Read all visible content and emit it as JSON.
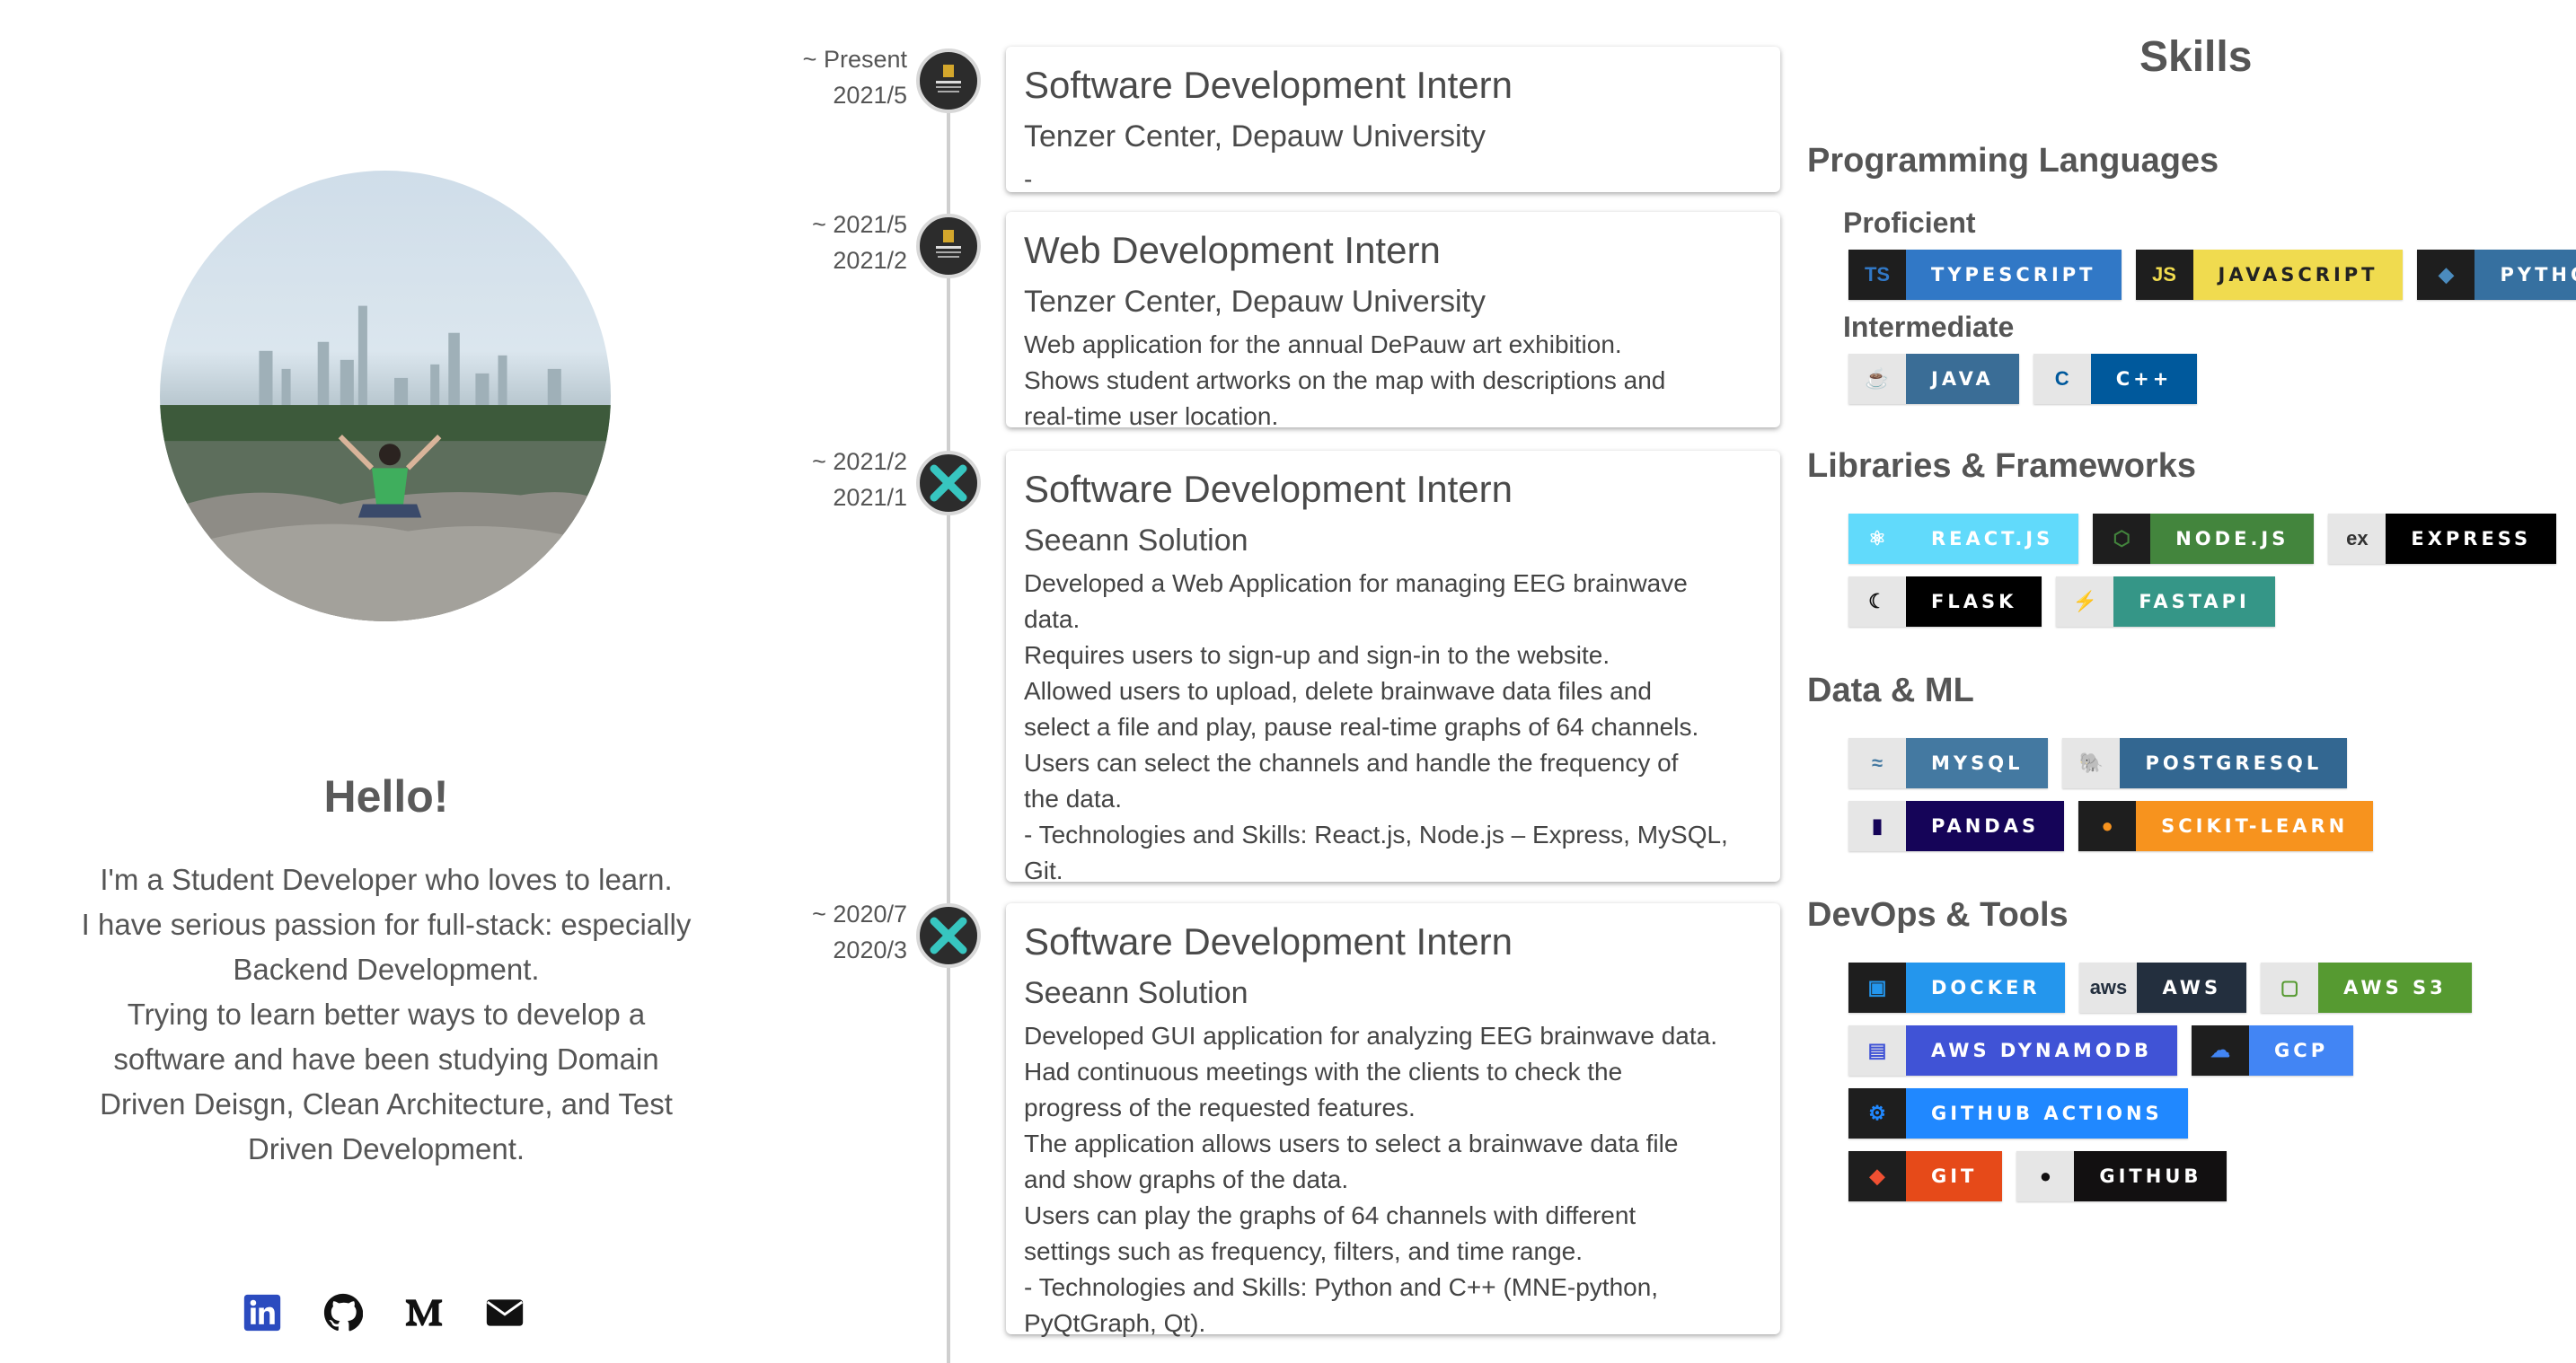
{
  "profile": {
    "greeting": "Hello!",
    "bio_lines": [
      "I'm a Student Developer who loves to learn.",
      "I have serious passion for full-stack: especially",
      "Backend Development.",
      "Trying to learn better ways to develop a",
      "software and have been studying Domain",
      "Driven Deisgn, Clean Architecture, and Test",
      "Driven Development."
    ],
    "socials": [
      "linkedin-icon",
      "github-icon",
      "medium-icon",
      "email-icon"
    ]
  },
  "timeline": [
    {
      "date_end": "~ Present",
      "date_start": "2021/5",
      "logo": "depauw-logo",
      "title": "Software Development Intern",
      "org": "Tenzer Center, Depauw University",
      "desc": [
        "-"
      ]
    },
    {
      "date_end": "~ 2021/5",
      "date_start": "2021/2",
      "logo": "depauw-logo",
      "title": "Web Development Intern",
      "org": "Tenzer Center, Depauw University",
      "desc": [
        "Web application for the annual DePauw art exhibition.",
        "Shows student artworks on the map with descriptions and",
        "real-time user location."
      ]
    },
    {
      "date_end": "~ 2021/2",
      "date_start": "2021/1",
      "logo": "seeann-logo",
      "title": "Software Development Intern",
      "org": "Seeann Solution",
      "desc": [
        "Developed a Web Application for managing EEG brainwave",
        "data.",
        "Requires users to sign-up and sign-in to the website.",
        "Allowed users to upload, delete brainwave data files and",
        "select a file and play, pause real-time graphs of 64 channels.",
        "Users can select the channels and handle the frequency of",
        "the data.",
        "- Technologies and Skills: React.js, Node.js – Express, MySQL,",
        "Git."
      ]
    },
    {
      "date_end": "~ 2020/7",
      "date_start": "2020/3",
      "logo": "seeann-logo",
      "title": "Software Development Intern",
      "org": "Seeann Solution",
      "desc": [
        "Developed GUI application for analyzing EEG brainwave data.",
        "Had continuous meetings with the clients to check the",
        "progress of the requested features.",
        "The application allows users to select a brainwave data file",
        "and show graphs of the data.",
        "Users can play the graphs of 64 channels with different",
        "settings such as frequency, filters, and time range.",
        "- Technologies and Skills: Python and C++ (MNE-python,",
        "PyQtGraph, Qt)."
      ]
    }
  ],
  "skills": {
    "title": "Skills",
    "categories": {
      "languages": {
        "label": "Programming Languages",
        "proficient_label": "Proficient",
        "intermediate_label": "Intermediate",
        "proficient": [
          {
            "label": "TYPESCRIPT",
            "icon": "typescript-icon",
            "color": "#3178c6",
            "icon_bg": "#1e1e1e"
          },
          {
            "label": "JAVASCRIPT",
            "icon": "javascript-icon",
            "color": "#f0db4f",
            "icon_bg": "#1e1e1e"
          },
          {
            "label": "PYTHON",
            "icon": "python-icon",
            "color": "#3670a0",
            "icon_bg": "#1e1e1e"
          }
        ],
        "intermediate": [
          {
            "label": "JAVA",
            "icon": "java-icon",
            "color": "#3a6d96",
            "icon_bg": "#e6e6e6"
          },
          {
            "label": "C++",
            "icon": "cplusplus-icon",
            "color": "#00599c",
            "icon_bg": "#e6e6e6"
          }
        ]
      },
      "frameworks": {
        "label": "Libraries & Frameworks",
        "row1": [
          {
            "label": "REACT.JS",
            "icon": "react-icon",
            "color": "#61dafb",
            "icon_bg": "#61dafb"
          },
          {
            "label": "NODE.JS",
            "icon": "nodejs-icon",
            "color": "#43853d",
            "icon_bg": "#1e1e1e"
          },
          {
            "label": "EXPRESS",
            "icon": "express-icon",
            "color": "#000000",
            "icon_bg": "#e6e6e6"
          }
        ],
        "row2": [
          {
            "label": "FLASK",
            "icon": "flask-icon",
            "color": "#000000",
            "icon_bg": "#e6e6e6"
          },
          {
            "label": "FASTAPI",
            "icon": "fastapi-icon",
            "color": "#359687",
            "icon_bg": "#e6e6e6"
          }
        ]
      },
      "data": {
        "label": "Data & ML",
        "row1": [
          {
            "label": "MYSQL",
            "icon": "mysql-icon",
            "color": "#4479a1",
            "icon_bg": "#e6e6e6"
          },
          {
            "label": "POSTGRESQL",
            "icon": "postgresql-icon",
            "color": "#336791",
            "icon_bg": "#e6e6e6"
          }
        ],
        "row2": [
          {
            "label": "PANDAS",
            "icon": "pandas-icon",
            "color": "#150458",
            "icon_bg": "#e6e6e6"
          },
          {
            "label": "SCIKIT-LEARN",
            "icon": "scikit-learn-icon",
            "color": "#f7931e",
            "icon_bg": "#1e1e1e"
          }
        ]
      },
      "devops": {
        "label": "DevOps & Tools",
        "row1": [
          {
            "label": "DOCKER",
            "icon": "docker-icon",
            "color": "#2496ed",
            "icon_bg": "#1e1e1e"
          },
          {
            "label": "AWS",
            "icon": "aws-icon",
            "color": "#232f3e",
            "icon_bg": "#e6e6e6"
          },
          {
            "label": "AWS S3",
            "icon": "aws-s3-icon",
            "color": "#569a31",
            "icon_bg": "#e6e6e6"
          }
        ],
        "row2": [
          {
            "label": "AWS DYNAMODB",
            "icon": "dynamodb-icon",
            "color": "#4053d6",
            "icon_bg": "#e6e6e6"
          },
          {
            "label": "GCP",
            "icon": "gcp-icon",
            "color": "#4285f4",
            "icon_bg": "#1e1e1e"
          }
        ],
        "row3": [
          {
            "label": "GITHUB ACTIONS",
            "icon": "github-actions-icon",
            "color": "#2088ff",
            "icon_bg": "#1e1e1e"
          }
        ],
        "row4": [
          {
            "label": "GIT",
            "icon": "git-icon",
            "color": "#e64a19",
            "icon_bg": "#1e1e1e"
          },
          {
            "label": "GITHUB",
            "icon": "github-icon",
            "color": "#121011",
            "icon_bg": "#e6e6e6"
          }
        ]
      }
    }
  }
}
